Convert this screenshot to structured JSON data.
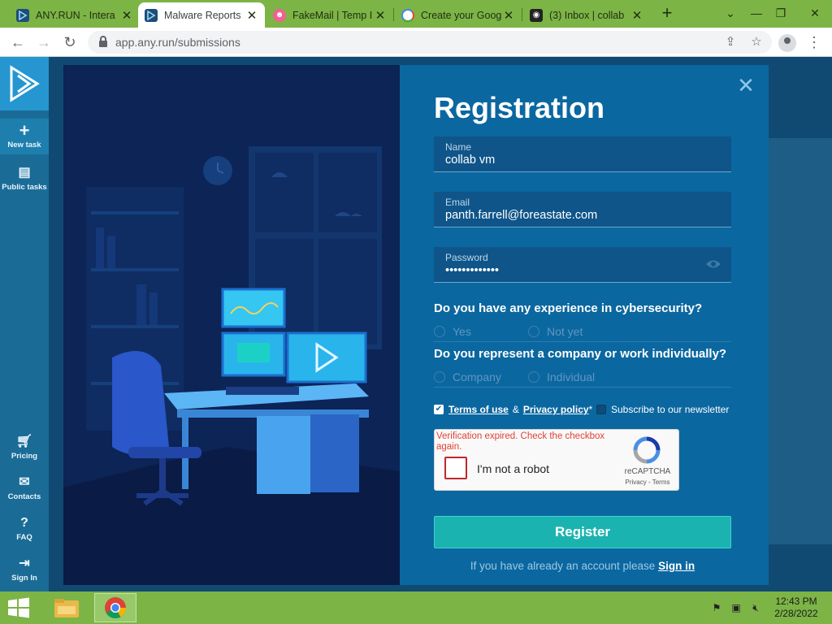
{
  "browser": {
    "tabs": [
      {
        "title": "ANY.RUN - Intera",
        "icon": "anyrun-icon",
        "active": false
      },
      {
        "title": "Malware Reports",
        "icon": "anyrun-icon",
        "active": true
      },
      {
        "title": "FakeMail | Temp I",
        "icon": "fakemail-icon",
        "active": false
      },
      {
        "title": "Create your Goog",
        "icon": "google-icon",
        "active": false
      },
      {
        "title": "(3) Inbox | collab",
        "icon": "inbox-icon",
        "active": false
      }
    ],
    "url": "app.any.run/submissions"
  },
  "sidebar": {
    "items": [
      {
        "label": "New task",
        "icon": "plus-icon"
      },
      {
        "label": "Public tasks",
        "icon": "document-icon"
      },
      {
        "label": "Pricing",
        "icon": "cart-icon"
      },
      {
        "label": "Contacts",
        "icon": "mail-icon"
      },
      {
        "label": "FAQ",
        "icon": "help-icon"
      },
      {
        "label": "Sign In",
        "icon": "sign-in-icon"
      }
    ]
  },
  "registration": {
    "title": "Registration",
    "fields": {
      "name": {
        "label": "Name",
        "value": "collab vm"
      },
      "email": {
        "label": "Email",
        "value": "panth.farrell@foreastate.com"
      },
      "password": {
        "label": "Password",
        "value": "•••••••••••••"
      }
    },
    "q1": {
      "question": "Do you have any experience in cybersecurity?",
      "options": [
        "Yes",
        "Not yet"
      ]
    },
    "q2": {
      "question": "Do you represent a company or work individually?",
      "options": [
        "Company",
        "Individual"
      ]
    },
    "terms": {
      "checked": true,
      "terms_label": "Terms of use",
      "amp": "&",
      "privacy_label": "Privacy policy",
      "required_mark": "*"
    },
    "newsletter": {
      "checked": false,
      "label": "Subscribe to our newsletter"
    },
    "recaptcha": {
      "error": "Verification expired. Check the checkbox again.",
      "label": "I'm not a robot",
      "brand": "reCAPTCHA",
      "links": "Privacy - Terms"
    },
    "register_label": "Register",
    "signin_prompt": "If you have already an account please",
    "signin_link": "Sign in"
  },
  "taskbar": {
    "time": "12:43 PM",
    "date": "2/28/2022"
  },
  "colors": {
    "accent": "#1bb3b0",
    "form_bg": "#0b67a0",
    "sidebar_bg": "#1a6c97",
    "error": "#e04236"
  }
}
